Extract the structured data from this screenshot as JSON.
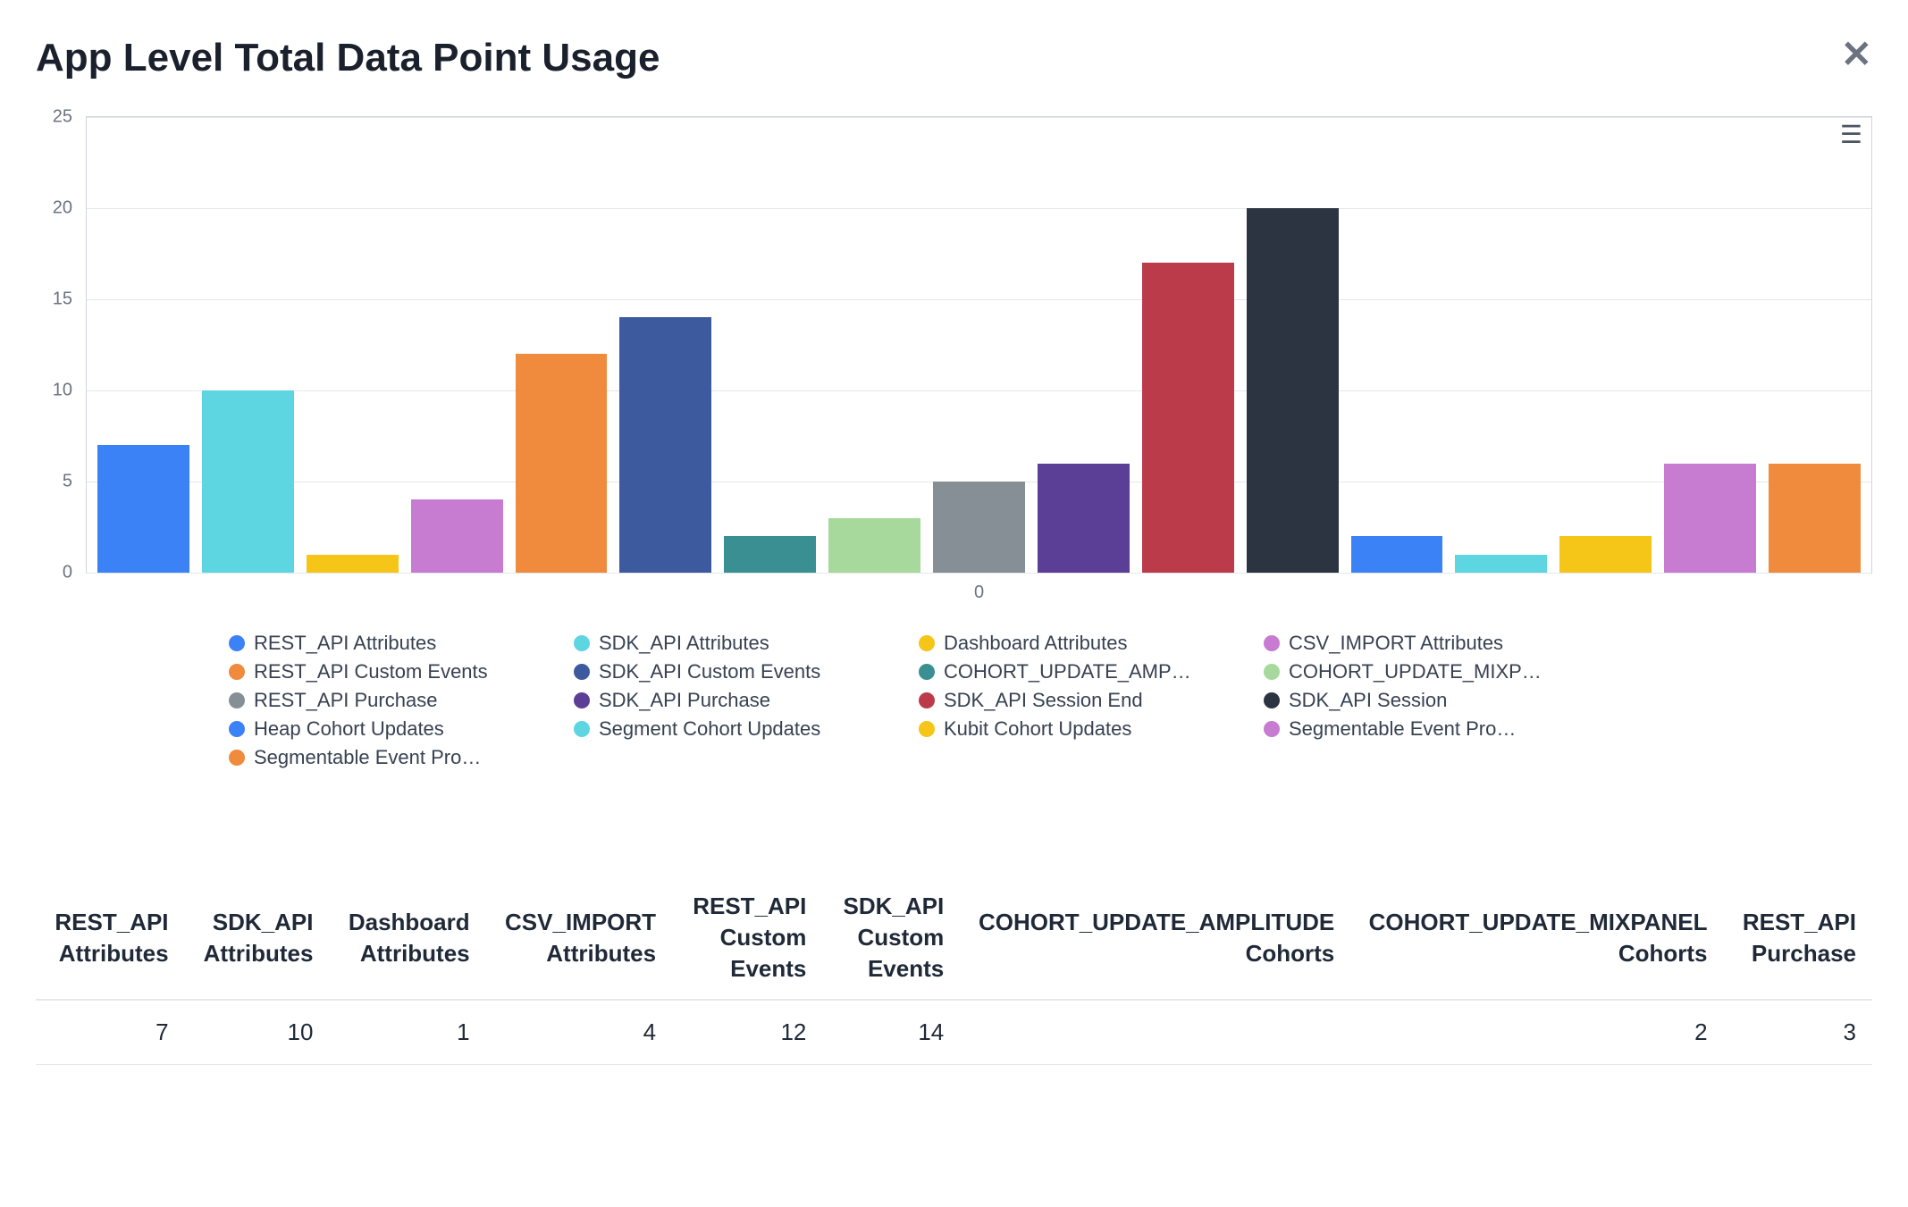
{
  "title": "App Level Total Data Point Usage",
  "x_center_label": "0",
  "chart_data": {
    "type": "bar",
    "ylim": [
      0,
      25
    ],
    "yticks": [
      0,
      5,
      10,
      15,
      20,
      25
    ],
    "series": [
      {
        "name": "REST_API Attributes",
        "value": 7,
        "color": "#3b82f6"
      },
      {
        "name": "SDK_API Attributes",
        "value": 10,
        "color": "#5dd6e2"
      },
      {
        "name": "Dashboard Attributes",
        "value": 1,
        "color": "#f5c518"
      },
      {
        "name": "CSV_IMPORT Attributes",
        "value": 4,
        "color": "#c77bd1"
      },
      {
        "name": "REST_API Custom Events",
        "value": 12,
        "color": "#f08a3c"
      },
      {
        "name": "SDK_API Custom Events",
        "value": 14,
        "color": "#3d5a9e"
      },
      {
        "name": "COHORT_UPDATE_AMP…",
        "value": 2,
        "color": "#3a8f92"
      },
      {
        "name": "COHORT_UPDATE_MIXP…",
        "value": 3,
        "color": "#a7d99c"
      },
      {
        "name": "REST_API Purchase",
        "value": 5,
        "color": "#868e96"
      },
      {
        "name": "SDK_API Purchase",
        "value": 6,
        "color": "#5b3e96"
      },
      {
        "name": "SDK_API Session End",
        "value": 17,
        "color": "#bb3b4a"
      },
      {
        "name": "SDK_API Session",
        "value": 20,
        "color": "#2b3440"
      },
      {
        "name": "Heap Cohort Updates",
        "value": 2,
        "color": "#3b82f6"
      },
      {
        "name": "Segment Cohort Updates",
        "value": 1,
        "color": "#5dd6e2"
      },
      {
        "name": "Kubit Cohort Updates",
        "value": 2,
        "color": "#f5c518"
      },
      {
        "name": "Segmentable Event Pro…",
        "value": 6,
        "color": "#c77bd1"
      },
      {
        "name": "Segmentable Event Pro…",
        "value": 6,
        "color": "#f08a3c"
      }
    ]
  },
  "table": {
    "headers": [
      "REST_API Attributes",
      "SDK_API Attributes",
      "Dashboard Attributes",
      "CSV_IMPORT Attributes",
      "REST_API Custom Events",
      "SDK_API Custom Events",
      "COHORT_UPDATE_AMPLITUDE Cohorts",
      "COHORT_UPDATE_MIXPANEL Cohorts",
      "REST_API Purchase"
    ],
    "row": [
      "7",
      "10",
      "1",
      "4",
      "12",
      "14",
      "",
      "2",
      "3"
    ]
  }
}
